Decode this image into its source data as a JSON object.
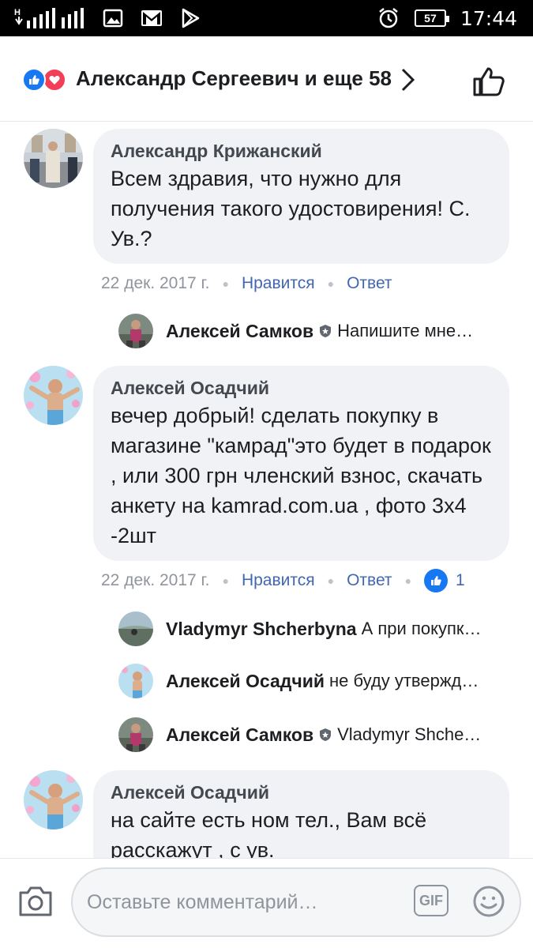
{
  "status_bar": {
    "network": "H",
    "battery": "57",
    "time": "17:44"
  },
  "header": {
    "reactions_text": "Александр Сергеевич и еще 58"
  },
  "comments": [
    {
      "author": "Александр Крижанский",
      "text": "Всем здравия, что нужно для получения такого удостовирения! С. Ув.?",
      "date": "22 дек. 2017 г.",
      "like_label": "Нравится",
      "reply_label": "Ответ",
      "replies": [
        {
          "author": "Алексей Самков",
          "text": "Напишите мне…"
        }
      ]
    },
    {
      "author": "Алексей Осадчий",
      "text": "вечер добрый! сделать покупку в магазине \"камрад\"это будет в подарок , или 300 грн членский взнос, скачать анкету на kamrad.com.ua , фото 3х4 -2шт",
      "date": "22 дек. 2017 г.",
      "like_label": "Нравится",
      "reply_label": "Ответ",
      "like_count": "1",
      "replies": [
        {
          "author": "Vladymyr Shcherbyna",
          "text": "А при покупк…"
        },
        {
          "author": "Алексей Осадчий",
          "text": "не буду утвержд…"
        },
        {
          "author": "Алексей Самков",
          "text": "Vladymyr Shche…"
        }
      ]
    },
    {
      "author": "Алексей Осадчий",
      "text": "на сайте есть ном тел., Вам всё расскажут , с ув."
    }
  ],
  "composer": {
    "placeholder": "Оставьте комментарий…",
    "gif_label": "GIF"
  },
  "colors": {
    "facebook_blue": "#1877f2",
    "link_blue": "#4267b2",
    "love_red": "#f33e58",
    "bubble_gray": "#f0f2f5"
  }
}
